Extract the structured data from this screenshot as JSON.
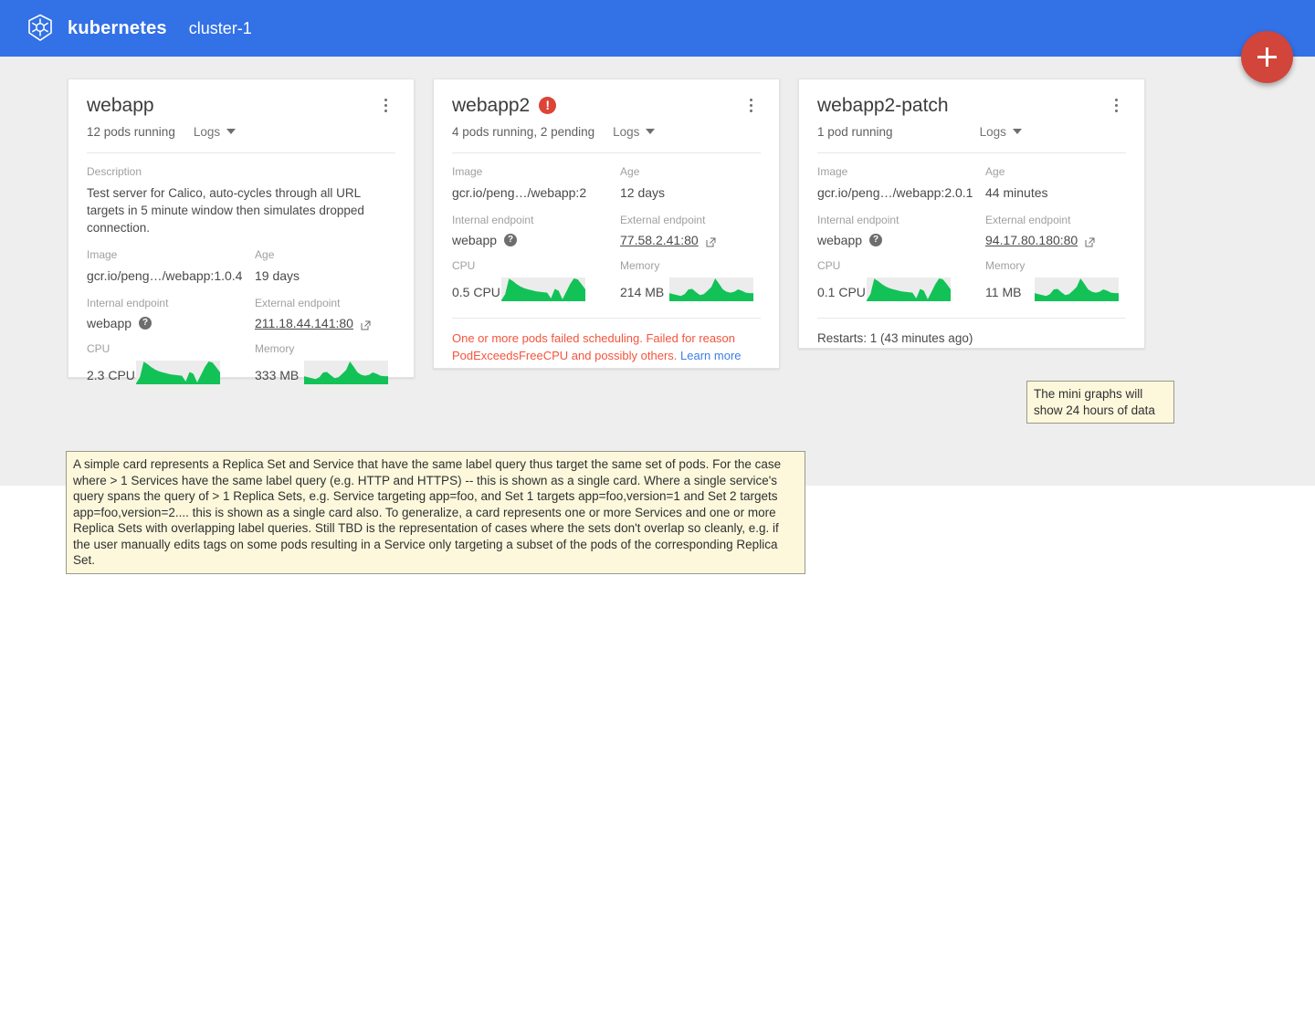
{
  "appbar": {
    "brand": "kubernetes",
    "cluster": "cluster-1",
    "logo_icon": "kubernetes-helm-logo",
    "accent_color": "#3271e6"
  },
  "fab": {
    "label": "+",
    "icon": "plus-icon",
    "color": "#d2453a"
  },
  "labels": {
    "description": "Description",
    "image": "Image",
    "age": "Age",
    "internal_endpoint": "Internal endpoint",
    "external_endpoint": "External endpoint",
    "cpu": "CPU",
    "memory": "Memory",
    "logs": "Logs",
    "help_glyph": "?",
    "error_glyph": "!"
  },
  "cards": [
    {
      "title": "webapp",
      "has_error": false,
      "pods": "12 pods running",
      "logs": "Logs",
      "description": "Test server for Calico, auto-cycles through all URL targets in 5 minute window then simulates dropped connection.",
      "image": "gcr.io/peng…/webapp:1.0.4",
      "age": "19 days",
      "internal_endpoint": "webapp",
      "external_endpoint": "211.18.44.141:80",
      "cpu": "2.3 CPU",
      "memory": "333 MB",
      "cpu_spark": [
        4,
        30,
        95,
        85,
        72,
        62,
        55,
        50,
        46,
        42,
        40,
        38,
        36,
        12,
        52,
        44,
        8,
        40,
        72,
        96,
        92,
        72,
        50
      ],
      "mem_spark": [
        34,
        30,
        26,
        22,
        30,
        50,
        52,
        38,
        26,
        30,
        44,
        60,
        96,
        74,
        50,
        40,
        36,
        40,
        50,
        44,
        36,
        34,
        34
      ]
    },
    {
      "title": "webapp2",
      "has_error": true,
      "pods": "4 pods running, 2 pending",
      "logs": "Logs",
      "description": null,
      "image": "gcr.io/peng…/webapp:2",
      "age": "12 days",
      "internal_endpoint": "webapp",
      "external_endpoint": "77.58.2.41:80",
      "cpu": "0.5 CPU",
      "memory": "214 MB",
      "cpu_spark": [
        4,
        30,
        95,
        85,
        72,
        62,
        55,
        50,
        46,
        42,
        40,
        38,
        36,
        12,
        52,
        44,
        8,
        40,
        72,
        96,
        92,
        72,
        50
      ],
      "mem_spark": [
        34,
        30,
        26,
        22,
        30,
        50,
        52,
        38,
        26,
        30,
        44,
        60,
        96,
        74,
        50,
        40,
        36,
        40,
        50,
        44,
        36,
        34,
        34
      ],
      "error_text_1": "One or more pods failed scheduling.  Failed for reason",
      "error_text_2": "PodExceedsFreeCPU and possibly others.",
      "error_link": "Learn more"
    },
    {
      "title": "webapp2-patch",
      "has_error": false,
      "pods": "1 pod running",
      "logs": "Logs",
      "description": null,
      "image": "gcr.io/peng…/webapp:2.0.1",
      "age": "44 minutes",
      "internal_endpoint": "webapp",
      "external_endpoint": "94.17.80.180:80",
      "cpu": "0.1 CPU",
      "memory": "11 MB",
      "cpu_spark": [
        4,
        30,
        95,
        85,
        72,
        62,
        55,
        50,
        46,
        42,
        40,
        38,
        36,
        12,
        52,
        44,
        8,
        40,
        72,
        96,
        92,
        72,
        50
      ],
      "mem_spark": [
        34,
        30,
        26,
        22,
        30,
        50,
        52,
        38,
        26,
        30,
        44,
        60,
        96,
        74,
        50,
        40,
        36,
        40,
        50,
        44,
        36,
        34,
        34
      ],
      "restarts": "Restarts: 1 (43 minutes ago)"
    }
  ],
  "notes": {
    "graphs": "The mini graphs will show 24 hours of data",
    "card": "A simple card represents a Replica Set and Service that have the same label query thus target the same set of pods.  For the case where > 1 Services have the same label query (e.g. HTTP and HTTPS) -- this is shown as a single card.  Where a single service's query spans the query of > 1 Replica Sets, e.g. Service targeting app=foo, and Set 1 targets app=foo,version=1 and Set 2 targets app=foo,version=2.... this is shown as a single card also.  To generalize, a card represents one or more Services and one or more Replica Sets with overlapping label queries.  Still TBD is the representation of cases where the sets don't overlap so cleanly, e.g. if the user manually edits tags on some pods resulting in a Service only targeting a subset of the pods of the corresponding Replica Set."
  },
  "colors": {
    "spark_fill": "#12c257",
    "spark_bg": "#ececec",
    "error_red": "#f4543c",
    "link_blue": "#3d7ee8"
  }
}
